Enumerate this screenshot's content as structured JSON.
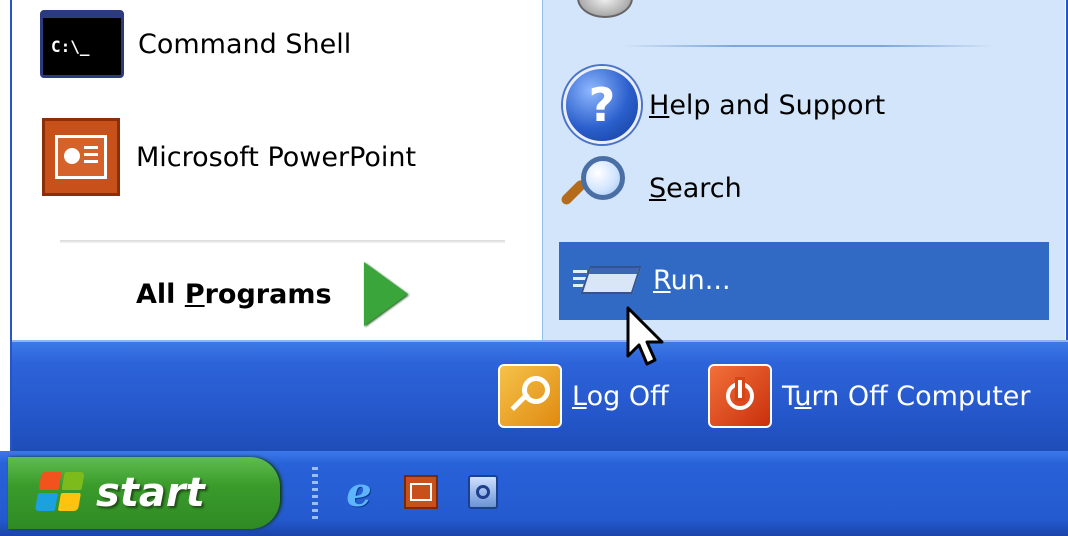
{
  "left": {
    "items": [
      {
        "label": "Command Shell"
      },
      {
        "label": "Microsoft PowerPoint"
      }
    ],
    "cmd_icon_text": "C:\\_",
    "all_programs": {
      "prefix": "All ",
      "underlined": "P",
      "suffix": "rograms"
    }
  },
  "right": {
    "help": {
      "underlined": "H",
      "rest": "elp and Support"
    },
    "search": {
      "underlined": "S",
      "rest": "earch"
    },
    "run": {
      "underlined": "R",
      "rest": "un..."
    }
  },
  "bottom": {
    "log_off": {
      "underlined": "L",
      "rest": "og Off"
    },
    "turn_off": {
      "prefix": "T",
      "underlined": "u",
      "rest": "rn Off Computer"
    }
  },
  "taskbar": {
    "start_label": "start",
    "quick_launch": [
      "internet-explorer-icon",
      "powerpoint-icon",
      "outlook-express-icon"
    ]
  },
  "colors": {
    "accent_blue": "#2456c9",
    "highlight": "#316ac5",
    "right_panel": "#d3e5fa",
    "start_green": "#3a9b2b"
  }
}
